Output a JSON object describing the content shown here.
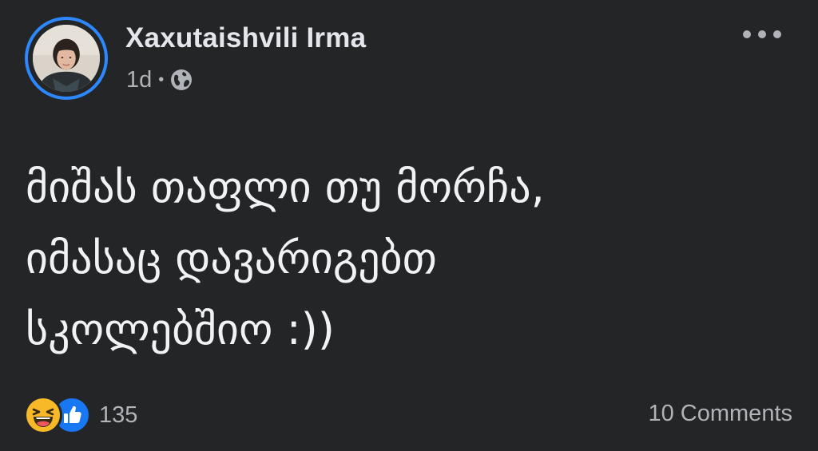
{
  "post": {
    "author": "Xaxutaishvili Irma",
    "time": "1d",
    "separator": "•",
    "audience_icon": "globe-icon",
    "more_icon": "more-options-icon",
    "text": "მიშას თაფლი თუ მორჩა,\nიმასაც დავარიგებთ\nსკოლებშიო :))",
    "reaction_icons": [
      "haha-reaction-icon",
      "like-reaction-icon"
    ],
    "reaction_count": "135",
    "comments_label": "10 Comments"
  },
  "colors": {
    "background": "#242526",
    "primary_text": "#e4e6eb",
    "secondary_text": "#b0b3b8",
    "avatar_ring": "#2d88ff",
    "like_blue": "#1877f2",
    "haha_yellow": "#f7b928"
  }
}
